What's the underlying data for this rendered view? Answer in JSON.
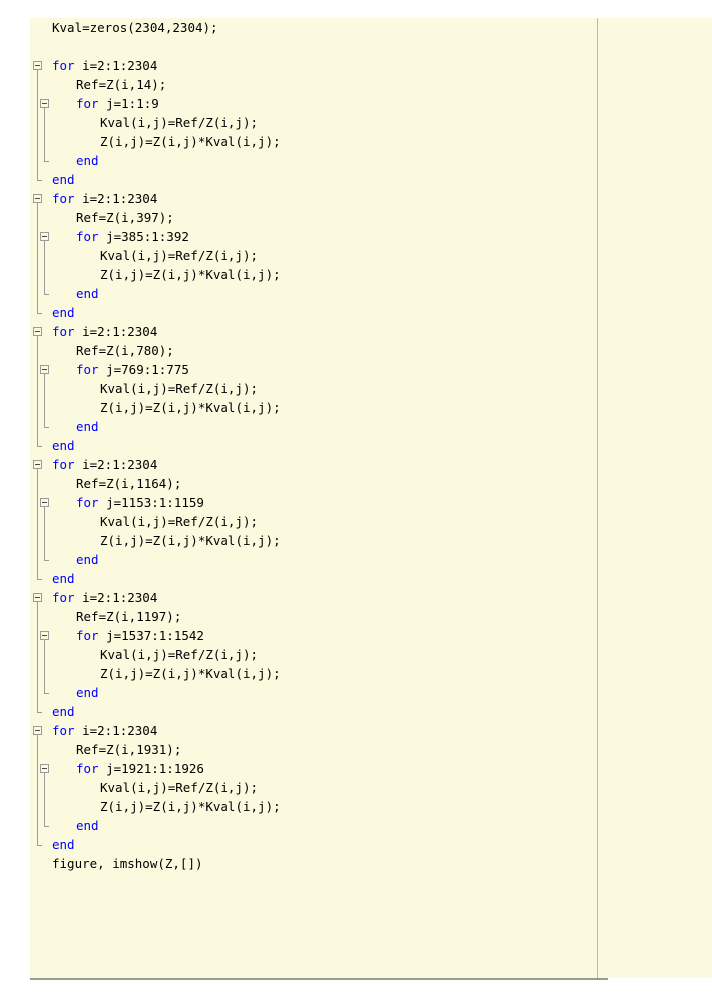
{
  "app": {
    "name": "MATLAB Editor",
    "view": "code-editor",
    "language": "MATLAB"
  },
  "colors": {
    "editor_background": "#fbfade",
    "page_background": "#ffffff",
    "keyword": "#0000ff",
    "text": "#000000",
    "fold_marker": "#9b9b9b",
    "margin_guide": "#b9b9ad",
    "bottom_rule": "#9a9a8e"
  },
  "editor": {
    "right_margin_guide_column": 75,
    "fold_gutter_visible": true,
    "line_numbers_visible": false
  },
  "code": {
    "lines": [
      {
        "n": 1,
        "indent": 1,
        "text": "Kval=zeros(2304,2304);"
      },
      {
        "n": 2,
        "indent": 1,
        "text": ""
      },
      {
        "n": 3,
        "indent": 1,
        "kw": "for",
        "text": " i=2:1:2304"
      },
      {
        "n": 4,
        "indent": 2,
        "text": "Ref=Z(i,14);"
      },
      {
        "n": 5,
        "indent": 2,
        "kw": "for",
        "text": " j=1:1:9"
      },
      {
        "n": 6,
        "indent": 3,
        "text": "Kval(i,j)=Ref/Z(i,j);"
      },
      {
        "n": 7,
        "indent": 3,
        "text": "Z(i,j)=Z(i,j)*Kval(i,j);"
      },
      {
        "n": 8,
        "indent": 2,
        "kw": "end",
        "text": ""
      },
      {
        "n": 9,
        "indent": 1,
        "kw": "end",
        "text": ""
      },
      {
        "n": 10,
        "indent": 1,
        "kw": "for",
        "text": " i=2:1:2304"
      },
      {
        "n": 11,
        "indent": 2,
        "text": "Ref=Z(i,397);"
      },
      {
        "n": 12,
        "indent": 2,
        "kw": "for",
        "text": " j=385:1:392"
      },
      {
        "n": 13,
        "indent": 3,
        "text": "Kval(i,j)=Ref/Z(i,j);"
      },
      {
        "n": 14,
        "indent": 3,
        "text": "Z(i,j)=Z(i,j)*Kval(i,j);"
      },
      {
        "n": 15,
        "indent": 2,
        "kw": "end",
        "text": ""
      },
      {
        "n": 16,
        "indent": 1,
        "kw": "end",
        "text": ""
      },
      {
        "n": 17,
        "indent": 1,
        "kw": "for",
        "text": " i=2:1:2304"
      },
      {
        "n": 18,
        "indent": 2,
        "text": "Ref=Z(i,780);"
      },
      {
        "n": 19,
        "indent": 2,
        "kw": "for",
        "text": " j=769:1:775"
      },
      {
        "n": 20,
        "indent": 3,
        "text": "Kval(i,j)=Ref/Z(i,j);"
      },
      {
        "n": 21,
        "indent": 3,
        "text": "Z(i,j)=Z(i,j)*Kval(i,j);"
      },
      {
        "n": 22,
        "indent": 2,
        "kw": "end",
        "text": ""
      },
      {
        "n": 23,
        "indent": 1,
        "kw": "end",
        "text": ""
      },
      {
        "n": 24,
        "indent": 1,
        "kw": "for",
        "text": " i=2:1:2304"
      },
      {
        "n": 25,
        "indent": 2,
        "text": "Ref=Z(i,1164);"
      },
      {
        "n": 26,
        "indent": 2,
        "kw": "for",
        "text": " j=1153:1:1159"
      },
      {
        "n": 27,
        "indent": 3,
        "text": "Kval(i,j)=Ref/Z(i,j);"
      },
      {
        "n": 28,
        "indent": 3,
        "text": "Z(i,j)=Z(i,j)*Kval(i,j);"
      },
      {
        "n": 29,
        "indent": 2,
        "kw": "end",
        "text": ""
      },
      {
        "n": 30,
        "indent": 1,
        "kw": "end",
        "text": ""
      },
      {
        "n": 31,
        "indent": 1,
        "kw": "for",
        "text": " i=2:1:2304"
      },
      {
        "n": 32,
        "indent": 2,
        "text": "Ref=Z(i,1197);"
      },
      {
        "n": 33,
        "indent": 2,
        "kw": "for",
        "text": " j=1537:1:1542"
      },
      {
        "n": 34,
        "indent": 3,
        "text": "Kval(i,j)=Ref/Z(i,j);"
      },
      {
        "n": 35,
        "indent": 3,
        "text": "Z(i,j)=Z(i,j)*Kval(i,j);"
      },
      {
        "n": 36,
        "indent": 2,
        "kw": "end",
        "text": ""
      },
      {
        "n": 37,
        "indent": 1,
        "kw": "end",
        "text": ""
      },
      {
        "n": 38,
        "indent": 1,
        "kw": "for",
        "text": " i=2:1:2304"
      },
      {
        "n": 39,
        "indent": 2,
        "text": "Ref=Z(i,1931);"
      },
      {
        "n": 40,
        "indent": 2,
        "kw": "for",
        "text": " j=1921:1:1926"
      },
      {
        "n": 41,
        "indent": 3,
        "text": "Kval(i,j)=Ref/Z(i,j);"
      },
      {
        "n": 42,
        "indent": 3,
        "text": "Z(i,j)=Z(i,j)*Kval(i,j);"
      },
      {
        "n": 43,
        "indent": 2,
        "kw": "end",
        "text": ""
      },
      {
        "n": 44,
        "indent": 1,
        "kw": "end",
        "text": ""
      },
      {
        "n": 45,
        "indent": 1,
        "text": "figure, imshow(Z,[])"
      }
    ]
  },
  "fold_markers": [
    {
      "line": 3,
      "level": 1,
      "state": "expanded"
    },
    {
      "line": 5,
      "level": 2,
      "state": "expanded"
    },
    {
      "line": 10,
      "level": 1,
      "state": "expanded"
    },
    {
      "line": 12,
      "level": 2,
      "state": "expanded"
    },
    {
      "line": 17,
      "level": 1,
      "state": "expanded"
    },
    {
      "line": 19,
      "level": 2,
      "state": "expanded"
    },
    {
      "line": 24,
      "level": 1,
      "state": "expanded"
    },
    {
      "line": 26,
      "level": 2,
      "state": "expanded"
    },
    {
      "line": 31,
      "level": 1,
      "state": "expanded"
    },
    {
      "line": 33,
      "level": 2,
      "state": "expanded"
    },
    {
      "line": 38,
      "level": 1,
      "state": "expanded"
    },
    {
      "line": 40,
      "level": 2,
      "state": "expanded"
    }
  ],
  "fold_blocks": [
    {
      "start": 3,
      "end": 9,
      "level": 1
    },
    {
      "start": 5,
      "end": 8,
      "level": 2
    },
    {
      "start": 10,
      "end": 16,
      "level": 1
    },
    {
      "start": 12,
      "end": 15,
      "level": 2
    },
    {
      "start": 17,
      "end": 23,
      "level": 1
    },
    {
      "start": 19,
      "end": 22,
      "level": 2
    },
    {
      "start": 24,
      "end": 30,
      "level": 1
    },
    {
      "start": 26,
      "end": 29,
      "level": 2
    },
    {
      "start": 31,
      "end": 37,
      "level": 1
    },
    {
      "start": 33,
      "end": 36,
      "level": 2
    },
    {
      "start": 38,
      "end": 44,
      "level": 1
    },
    {
      "start": 40,
      "end": 43,
      "level": 2
    }
  ]
}
